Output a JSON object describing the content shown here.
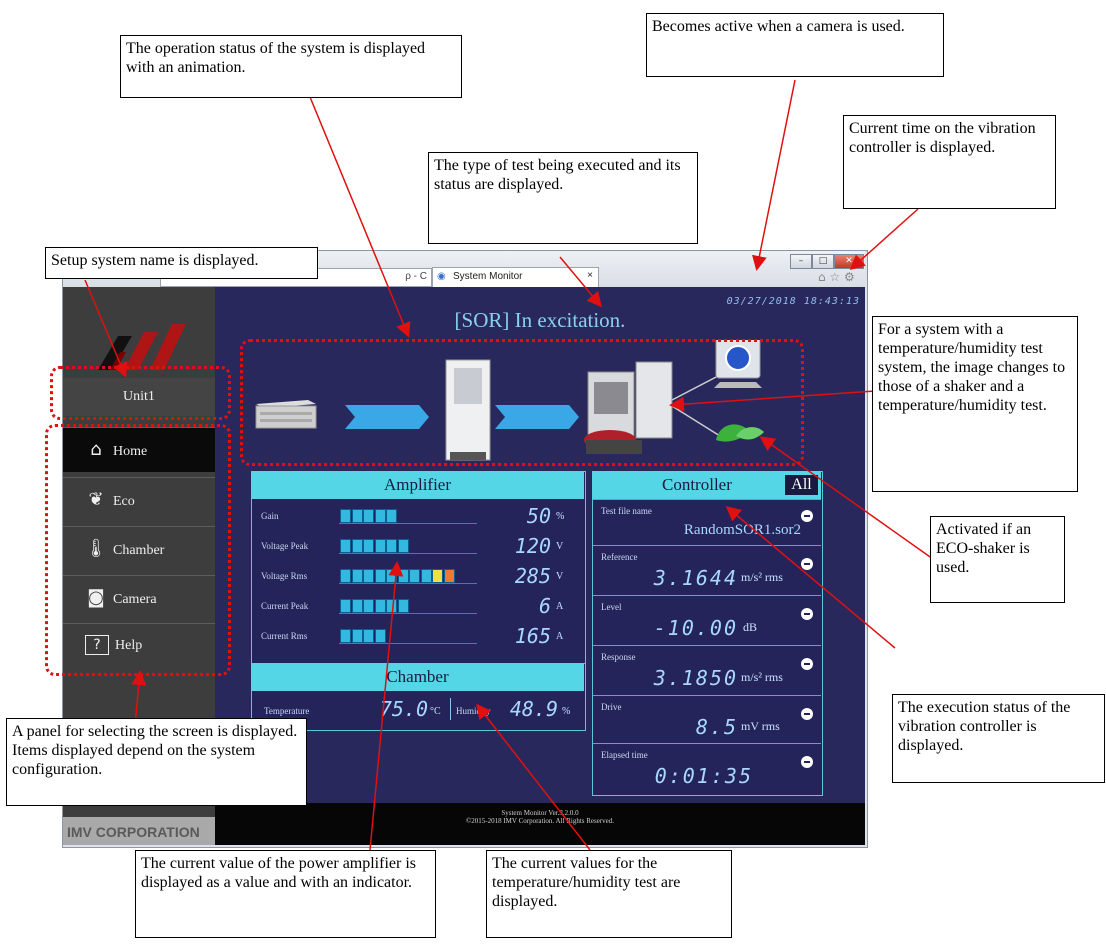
{
  "browser": {
    "address_text": "ρ - C",
    "tab_title": "System Monitor",
    "tab_close": "×",
    "nav_icons": "⌂ ☆ ⚙"
  },
  "app": {
    "datetime": "03/27/2018  18:43:13",
    "status": "[SOR] In excitation.",
    "unit_name": "Unit1",
    "nav": [
      {
        "label": "Home",
        "icon": "home-icon",
        "active": true
      },
      {
        "label": "Eco",
        "icon": "leaf-icon"
      },
      {
        "label": "Chamber",
        "icon": "thermometer-icon"
      },
      {
        "label": "Camera",
        "icon": "camera-icon"
      },
      {
        "label": "Help",
        "icon": "help-icon"
      }
    ],
    "company": "IMV CORPORATION",
    "footer_line1": "System Monitor Ver.3.2.0.0",
    "footer_line2": "©2015-2018 IMV Corporation. All Rights Reserved."
  },
  "amplifier": {
    "title": "Amplifier",
    "rows": [
      {
        "label": "Gain",
        "value": "50",
        "unit": "%",
        "segments": 5
      },
      {
        "label": "Voltage Peak",
        "value": "120",
        "unit": "V",
        "segments": 6
      },
      {
        "label": "Voltage Rms",
        "value": "285",
        "unit": "V",
        "segments": 10
      },
      {
        "label": "Current Peak",
        "value": "6",
        "unit": "A",
        "segments": 6
      },
      {
        "label": "Current Rms",
        "value": "165",
        "unit": "A",
        "segments": 4
      }
    ]
  },
  "chamber": {
    "title": "Chamber",
    "temperature_label": "Temperature",
    "temperature_value": "75.0",
    "temperature_unit": "°C",
    "humidity_label": "Humidity",
    "humidity_value": "48.9",
    "humidity_unit": "%"
  },
  "controller": {
    "title": "Controller",
    "all_label": "All",
    "test_file_label": "Test file name",
    "test_file_value": "RandomSOR1.sor2",
    "reference_label": "Reference",
    "reference_value": "3.1644",
    "reference_unit": "m/s² rms",
    "level_label": "Level",
    "level_value": "-10.00",
    "level_unit": "dB",
    "response_label": "Response",
    "response_value": "3.1850",
    "response_unit": "m/s² rms",
    "drive_label": "Drive",
    "drive_value": "8.5",
    "drive_unit": "mV rms",
    "elapsed_label": "Elapsed time",
    "elapsed_value": "0:01:35"
  },
  "annotations": {
    "animation": "The operation status of the system is displayed with an animation.",
    "camera": "Becomes active when a camera is used.",
    "time": "Current time on the vibration controller is displayed.",
    "test_type": "The type of test being executed and its status are displayed.",
    "system_name": "Setup system name is displayed.",
    "temp_system": "For a system with a temperature/humidity test system, the image changes to those of a shaker and a temperature/humidity test.",
    "eco": "Activated if an ECO-shaker is used.",
    "controller_status": "The execution status of the vibration controller is displayed.",
    "panel_select": "A panel for selecting the screen is displayed. Items displayed depend on the system configuration.",
    "amplifier_value": "The current value of the power amplifier is displayed as a value and with an indicator.",
    "chamber_values": "The current values for the temperature/humidity test are displayed."
  },
  "colors": {
    "background": "#29285c",
    "panel_title": "#55d6e6",
    "annotation_arrow": "#e01010"
  }
}
